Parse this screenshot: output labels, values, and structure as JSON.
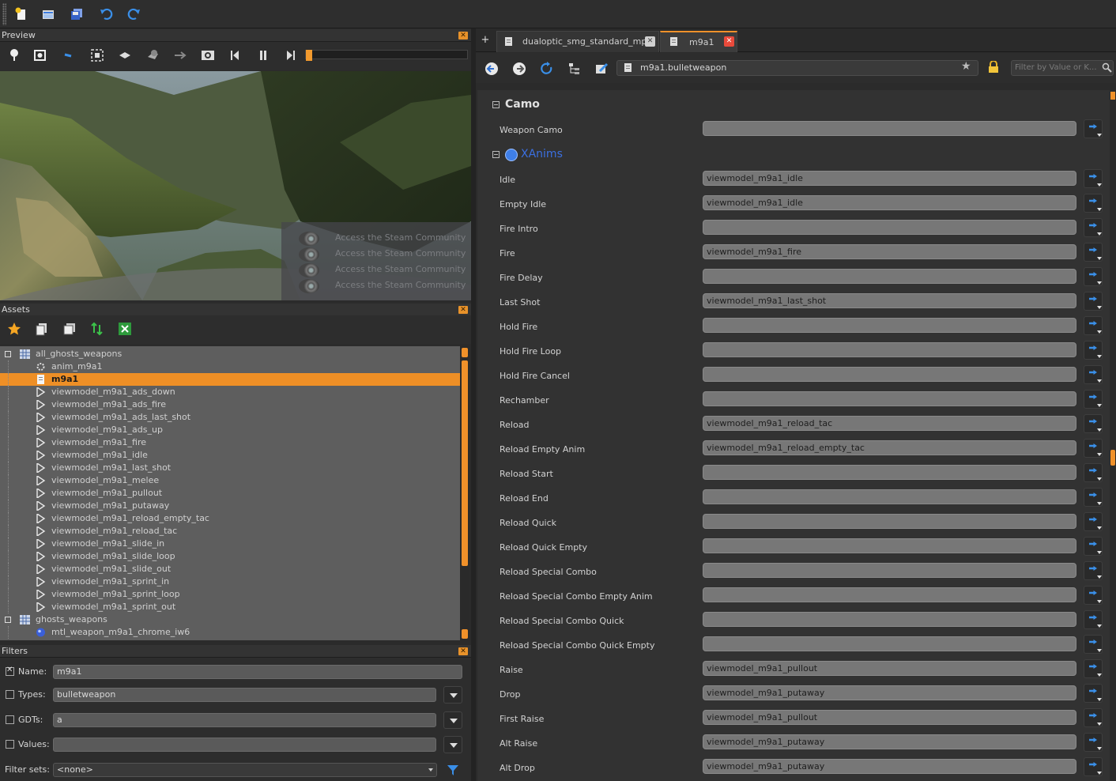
{
  "preview": {
    "header": "Preview"
  },
  "steam_overlay": [
    "Access the Steam Community",
    "Access the Steam Community",
    "Access the Steam Community",
    "Access the Steam Community"
  ],
  "assets": {
    "header": "Assets",
    "tree": [
      {
        "label": "all_ghosts_weapons",
        "level": 0,
        "icon": "grid-icon",
        "selected": false
      },
      {
        "label": "anim_m9a1",
        "level": 1,
        "icon": "gear-icon",
        "selected": false
      },
      {
        "label": "m9a1",
        "level": 1,
        "icon": "document-icon",
        "selected": true
      },
      {
        "label": "viewmodel_m9a1_ads_down",
        "level": 1,
        "icon": "play-icon",
        "selected": false
      },
      {
        "label": "viewmodel_m9a1_ads_fire",
        "level": 1,
        "icon": "play-icon",
        "selected": false
      },
      {
        "label": "viewmodel_m9a1_ads_last_shot",
        "level": 1,
        "icon": "play-icon",
        "selected": false
      },
      {
        "label": "viewmodel_m9a1_ads_up",
        "level": 1,
        "icon": "play-icon",
        "selected": false
      },
      {
        "label": "viewmodel_m9a1_fire",
        "level": 1,
        "icon": "play-icon",
        "selected": false
      },
      {
        "label": "viewmodel_m9a1_idle",
        "level": 1,
        "icon": "play-icon",
        "selected": false
      },
      {
        "label": "viewmodel_m9a1_last_shot",
        "level": 1,
        "icon": "play-icon",
        "selected": false
      },
      {
        "label": "viewmodel_m9a1_melee",
        "level": 1,
        "icon": "play-icon",
        "selected": false
      },
      {
        "label": "viewmodel_m9a1_pullout",
        "level": 1,
        "icon": "play-icon",
        "selected": false
      },
      {
        "label": "viewmodel_m9a1_putaway",
        "level": 1,
        "icon": "play-icon",
        "selected": false
      },
      {
        "label": "viewmodel_m9a1_reload_empty_tac",
        "level": 1,
        "icon": "play-icon",
        "selected": false
      },
      {
        "label": "viewmodel_m9a1_reload_tac",
        "level": 1,
        "icon": "play-icon",
        "selected": false
      },
      {
        "label": "viewmodel_m9a1_slide_in",
        "level": 1,
        "icon": "play-icon",
        "selected": false
      },
      {
        "label": "viewmodel_m9a1_slide_loop",
        "level": 1,
        "icon": "play-icon",
        "selected": false
      },
      {
        "label": "viewmodel_m9a1_slide_out",
        "level": 1,
        "icon": "play-icon",
        "selected": false
      },
      {
        "label": "viewmodel_m9a1_sprint_in",
        "level": 1,
        "icon": "play-icon",
        "selected": false
      },
      {
        "label": "viewmodel_m9a1_sprint_loop",
        "level": 1,
        "icon": "play-icon",
        "selected": false
      },
      {
        "label": "viewmodel_m9a1_sprint_out",
        "level": 1,
        "icon": "play-icon",
        "selected": false
      },
      {
        "label": "ghosts_weapons",
        "level": 0,
        "icon": "grid-icon",
        "selected": false
      },
      {
        "label": "mtl_weapon_m9a1_chrome_iw6",
        "level": 1,
        "icon": "material-icon",
        "selected": false
      }
    ]
  },
  "filters": {
    "header": "Filters",
    "name_label": "Name:",
    "name_value": "m9a1",
    "name_checked": true,
    "types_label": "Types:",
    "types_value": "bulletweapon",
    "gdts_label": "GDTs:",
    "gdts_value": "a",
    "values_label": "Values:",
    "values_value": "",
    "filtersets_label": "Filter sets:",
    "filtersets_value": "<none>"
  },
  "tabs": [
    {
      "label": "dualoptic_smg_standard_mp",
      "active": false
    },
    {
      "label": "m9a1",
      "active": true
    }
  ],
  "address": {
    "value": "m9a1.bulletweapon",
    "filter_placeholder": "Filter by Value or K..."
  },
  "camo": {
    "title": "Camo",
    "rows": [
      {
        "label": "Weapon Camo",
        "value": ""
      }
    ]
  },
  "xanims": {
    "title": "XAnims",
    "rows": [
      {
        "label": "Idle",
        "value": "viewmodel_m9a1_idle"
      },
      {
        "label": "Empty Idle",
        "value": "viewmodel_m9a1_idle"
      },
      {
        "label": "Fire Intro",
        "value": ""
      },
      {
        "label": "Fire",
        "value": "viewmodel_m9a1_fire"
      },
      {
        "label": "Fire Delay",
        "value": ""
      },
      {
        "label": "Last Shot",
        "value": "viewmodel_m9a1_last_shot"
      },
      {
        "label": "Hold Fire",
        "value": ""
      },
      {
        "label": "Hold Fire Loop",
        "value": ""
      },
      {
        "label": "Hold Fire Cancel",
        "value": ""
      },
      {
        "label": "Rechamber",
        "value": ""
      },
      {
        "label": "Reload",
        "value": "viewmodel_m9a1_reload_tac"
      },
      {
        "label": "Reload Empty Anim",
        "value": "viewmodel_m9a1_reload_empty_tac"
      },
      {
        "label": "Reload Start",
        "value": ""
      },
      {
        "label": "Reload End",
        "value": ""
      },
      {
        "label": "Reload Quick",
        "value": ""
      },
      {
        "label": "Reload Quick Empty",
        "value": ""
      },
      {
        "label": "Reload Special Combo",
        "value": ""
      },
      {
        "label": "Reload Special Combo Empty Anim",
        "value": ""
      },
      {
        "label": "Reload Special Combo Quick",
        "value": ""
      },
      {
        "label": "Reload Special Combo Quick Empty",
        "value": ""
      },
      {
        "label": "Raise",
        "value": "viewmodel_m9a1_pullout"
      },
      {
        "label": "Drop",
        "value": "viewmodel_m9a1_putaway"
      },
      {
        "label": "First Raise",
        "value": "viewmodel_m9a1_pullout"
      },
      {
        "label": "Alt Raise",
        "value": "viewmodel_m9a1_putaway"
      },
      {
        "label": "Alt Drop",
        "value": "viewmodel_m9a1_putaway"
      }
    ]
  },
  "colors": {
    "accent": "#f0912a",
    "link": "#3b6fe0",
    "selection": "#ee8f26"
  }
}
